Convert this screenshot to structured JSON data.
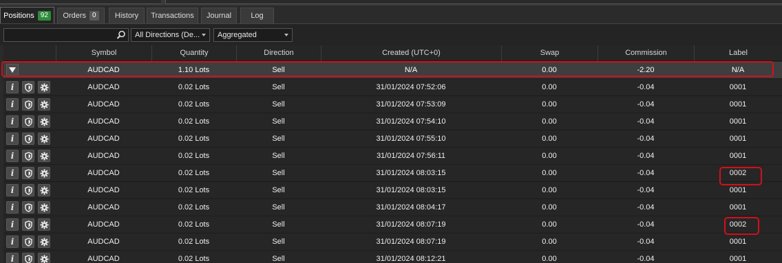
{
  "tabs": [
    {
      "label": "Positions",
      "badge": "92",
      "active": true
    },
    {
      "label": "Orders",
      "badge": "0"
    },
    {
      "label": "History"
    },
    {
      "label": "Transactions"
    },
    {
      "label": "Journal"
    },
    {
      "label": "Log"
    }
  ],
  "filters": {
    "search_value": "",
    "direction": "All Directions (De...",
    "grouping": "Aggregated"
  },
  "columns": [
    "Symbol",
    "Quantity",
    "Direction",
    "Created (UTC+0)",
    "Swap",
    "Commission",
    "Label"
  ],
  "aggregate_row": {
    "symbol": "AUDCAD",
    "quantity": "1.10 Lots",
    "direction": "Sell",
    "created": "N/A",
    "swap": "0.00",
    "commission": "-2.20",
    "label": "N/A"
  },
  "rows": [
    {
      "symbol": "AUDCAD",
      "quantity": "0.02 Lots",
      "direction": "Sell",
      "created": "31/01/2024 07:52:06",
      "swap": "0.00",
      "commission": "-0.04",
      "label": "0001"
    },
    {
      "symbol": "AUDCAD",
      "quantity": "0.02 Lots",
      "direction": "Sell",
      "created": "31/01/2024 07:53:09",
      "swap": "0.00",
      "commission": "-0.04",
      "label": "0001"
    },
    {
      "symbol": "AUDCAD",
      "quantity": "0.02 Lots",
      "direction": "Sell",
      "created": "31/01/2024 07:54:10",
      "swap": "0.00",
      "commission": "-0.04",
      "label": "0001"
    },
    {
      "symbol": "AUDCAD",
      "quantity": "0.02 Lots",
      "direction": "Sell",
      "created": "31/01/2024 07:55:10",
      "swap": "0.00",
      "commission": "-0.04",
      "label": "0001"
    },
    {
      "symbol": "AUDCAD",
      "quantity": "0.02 Lots",
      "direction": "Sell",
      "created": "31/01/2024 07:56:11",
      "swap": "0.00",
      "commission": "-0.04",
      "label": "0001"
    },
    {
      "symbol": "AUDCAD",
      "quantity": "0.02 Lots",
      "direction": "Sell",
      "created": "31/01/2024 08:03:15",
      "swap": "0.00",
      "commission": "-0.04",
      "label": "0002"
    },
    {
      "symbol": "AUDCAD",
      "quantity": "0.02 Lots",
      "direction": "Sell",
      "created": "31/01/2024 08:03:15",
      "swap": "0.00",
      "commission": "-0.04",
      "label": "0001"
    },
    {
      "symbol": "AUDCAD",
      "quantity": "0.02 Lots",
      "direction": "Sell",
      "created": "31/01/2024 08:04:17",
      "swap": "0.00",
      "commission": "-0.04",
      "label": "0001"
    },
    {
      "symbol": "AUDCAD",
      "quantity": "0.02 Lots",
      "direction": "Sell",
      "created": "31/01/2024 08:07:19",
      "swap": "0.00",
      "commission": "-0.04",
      "label": "0002"
    },
    {
      "symbol": "AUDCAD",
      "quantity": "0.02 Lots",
      "direction": "Sell",
      "created": "31/01/2024 08:07:19",
      "swap": "0.00",
      "commission": "-0.04",
      "label": "0001"
    },
    {
      "symbol": "AUDCAD",
      "quantity": "0.02 Lots",
      "direction": "Sell",
      "created": "31/01/2024 08:12:21",
      "swap": "0.00",
      "commission": "-0.04",
      "label": "0001"
    }
  ],
  "colors": {
    "badge_positions": "#2e8b3a",
    "highlight": "#d4101a",
    "background": "#2b2b2b"
  },
  "icons": {
    "row_actions": [
      "info-icon",
      "shield-icon",
      "gear-icon"
    ],
    "search": "search-icon",
    "expand": "collapse-triangle-icon"
  }
}
